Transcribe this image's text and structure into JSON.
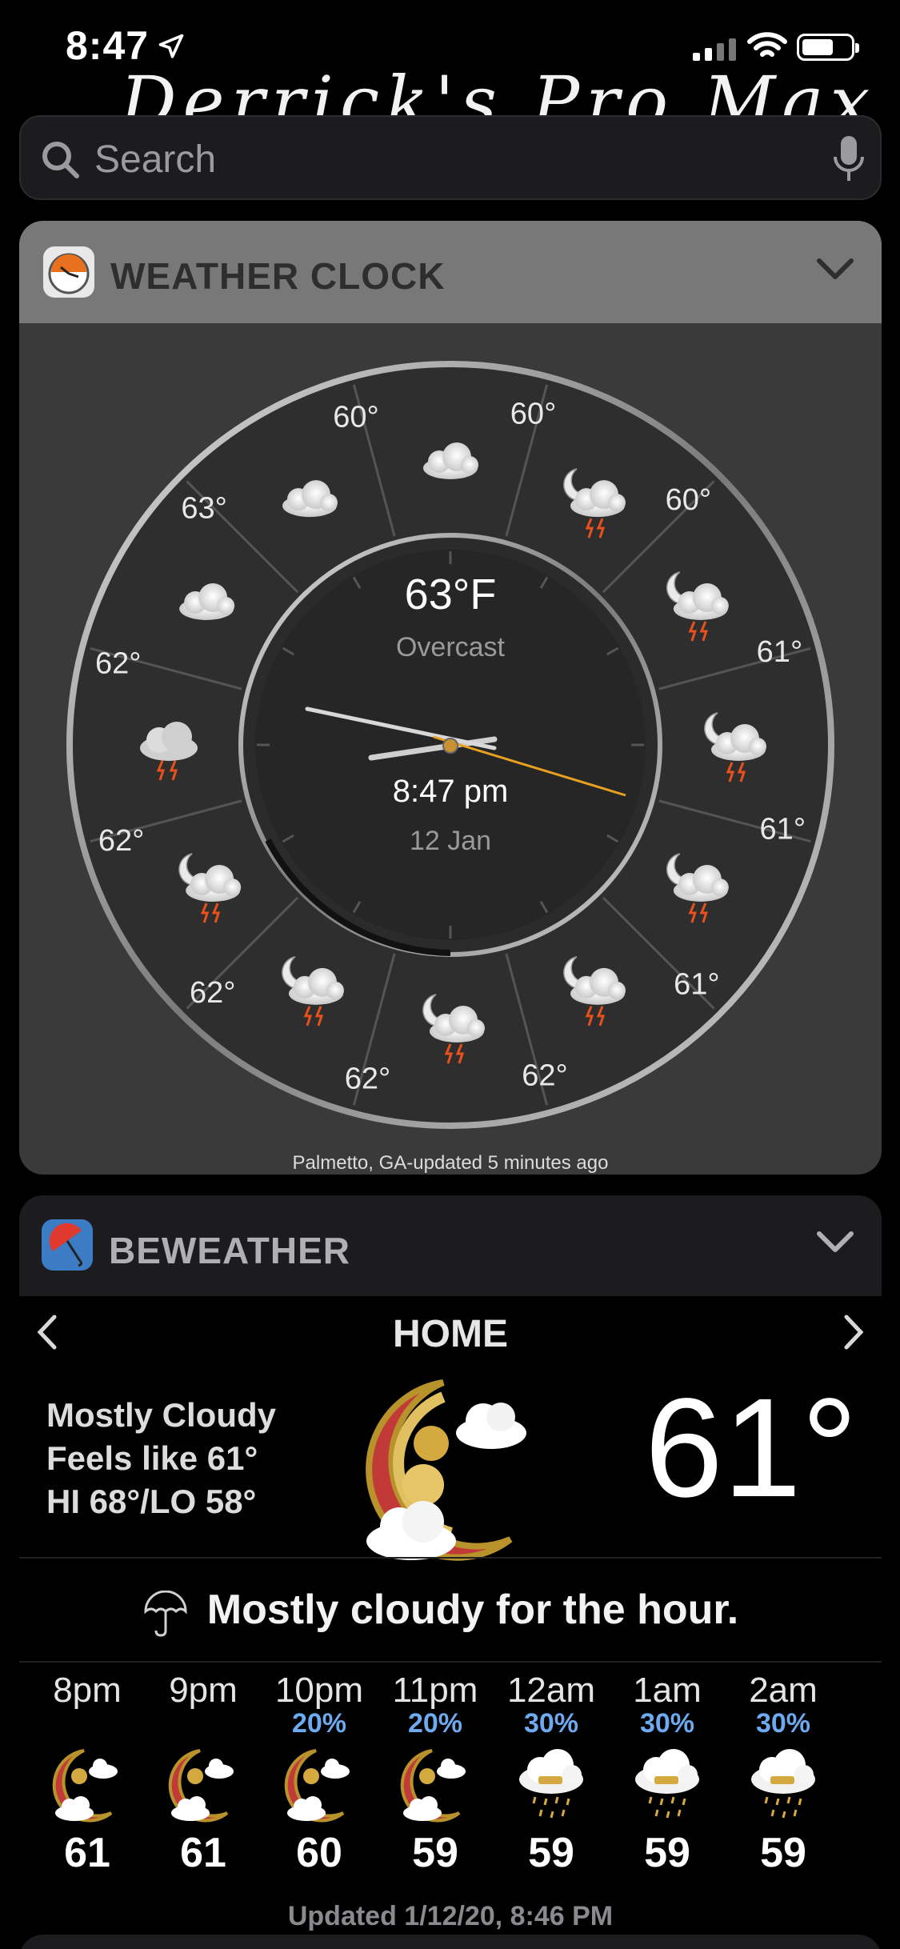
{
  "status_bar": {
    "time": "8:47"
  },
  "background": {
    "text": "Derrick's Pro Max"
  },
  "search": {
    "placeholder": "Search"
  },
  "weather_clock": {
    "title": "WEATHER CLOCK",
    "temperature": "63°F",
    "condition": "Overcast",
    "time": "8:47 pm",
    "date": "12 Jan",
    "footer": "Palmetto, GA-updated 5 minutes ago",
    "hour_temps": [
      "60°",
      "61°",
      "61°",
      "61°",
      "62°",
      "62°",
      "62°",
      "62°",
      "62°",
      "63°",
      "60°",
      "60°"
    ]
  },
  "beweather": {
    "title": "BEWEATHER",
    "location": "HOME",
    "conditions": [
      "Mostly Cloudy",
      "Feels like 61°",
      "HI 68°/LO 58°"
    ],
    "temperature": "61°",
    "hour_summary": "Mostly cloudy for the hour.",
    "hourly": [
      {
        "time": "8pm",
        "pop": "",
        "temp": "61",
        "icon": "moon-cloud-icon"
      },
      {
        "time": "9pm",
        "pop": "",
        "temp": "61",
        "icon": "moon-cloud-icon"
      },
      {
        "time": "10pm",
        "pop": "20%",
        "temp": "60",
        "icon": "moon-cloud-icon"
      },
      {
        "time": "11pm",
        "pop": "20%",
        "temp": "59",
        "icon": "moon-cloud-icon"
      },
      {
        "time": "12am",
        "pop": "30%",
        "temp": "59",
        "icon": "rain-cloud-icon"
      },
      {
        "time": "1am",
        "pop": "30%",
        "temp": "59",
        "icon": "rain-cloud-icon"
      },
      {
        "time": "2am",
        "pop": "30%",
        "temp": "59",
        "icon": "rain-cloud-icon"
      }
    ],
    "updated": "Updated 1/12/20, 8:46 PM"
  }
}
